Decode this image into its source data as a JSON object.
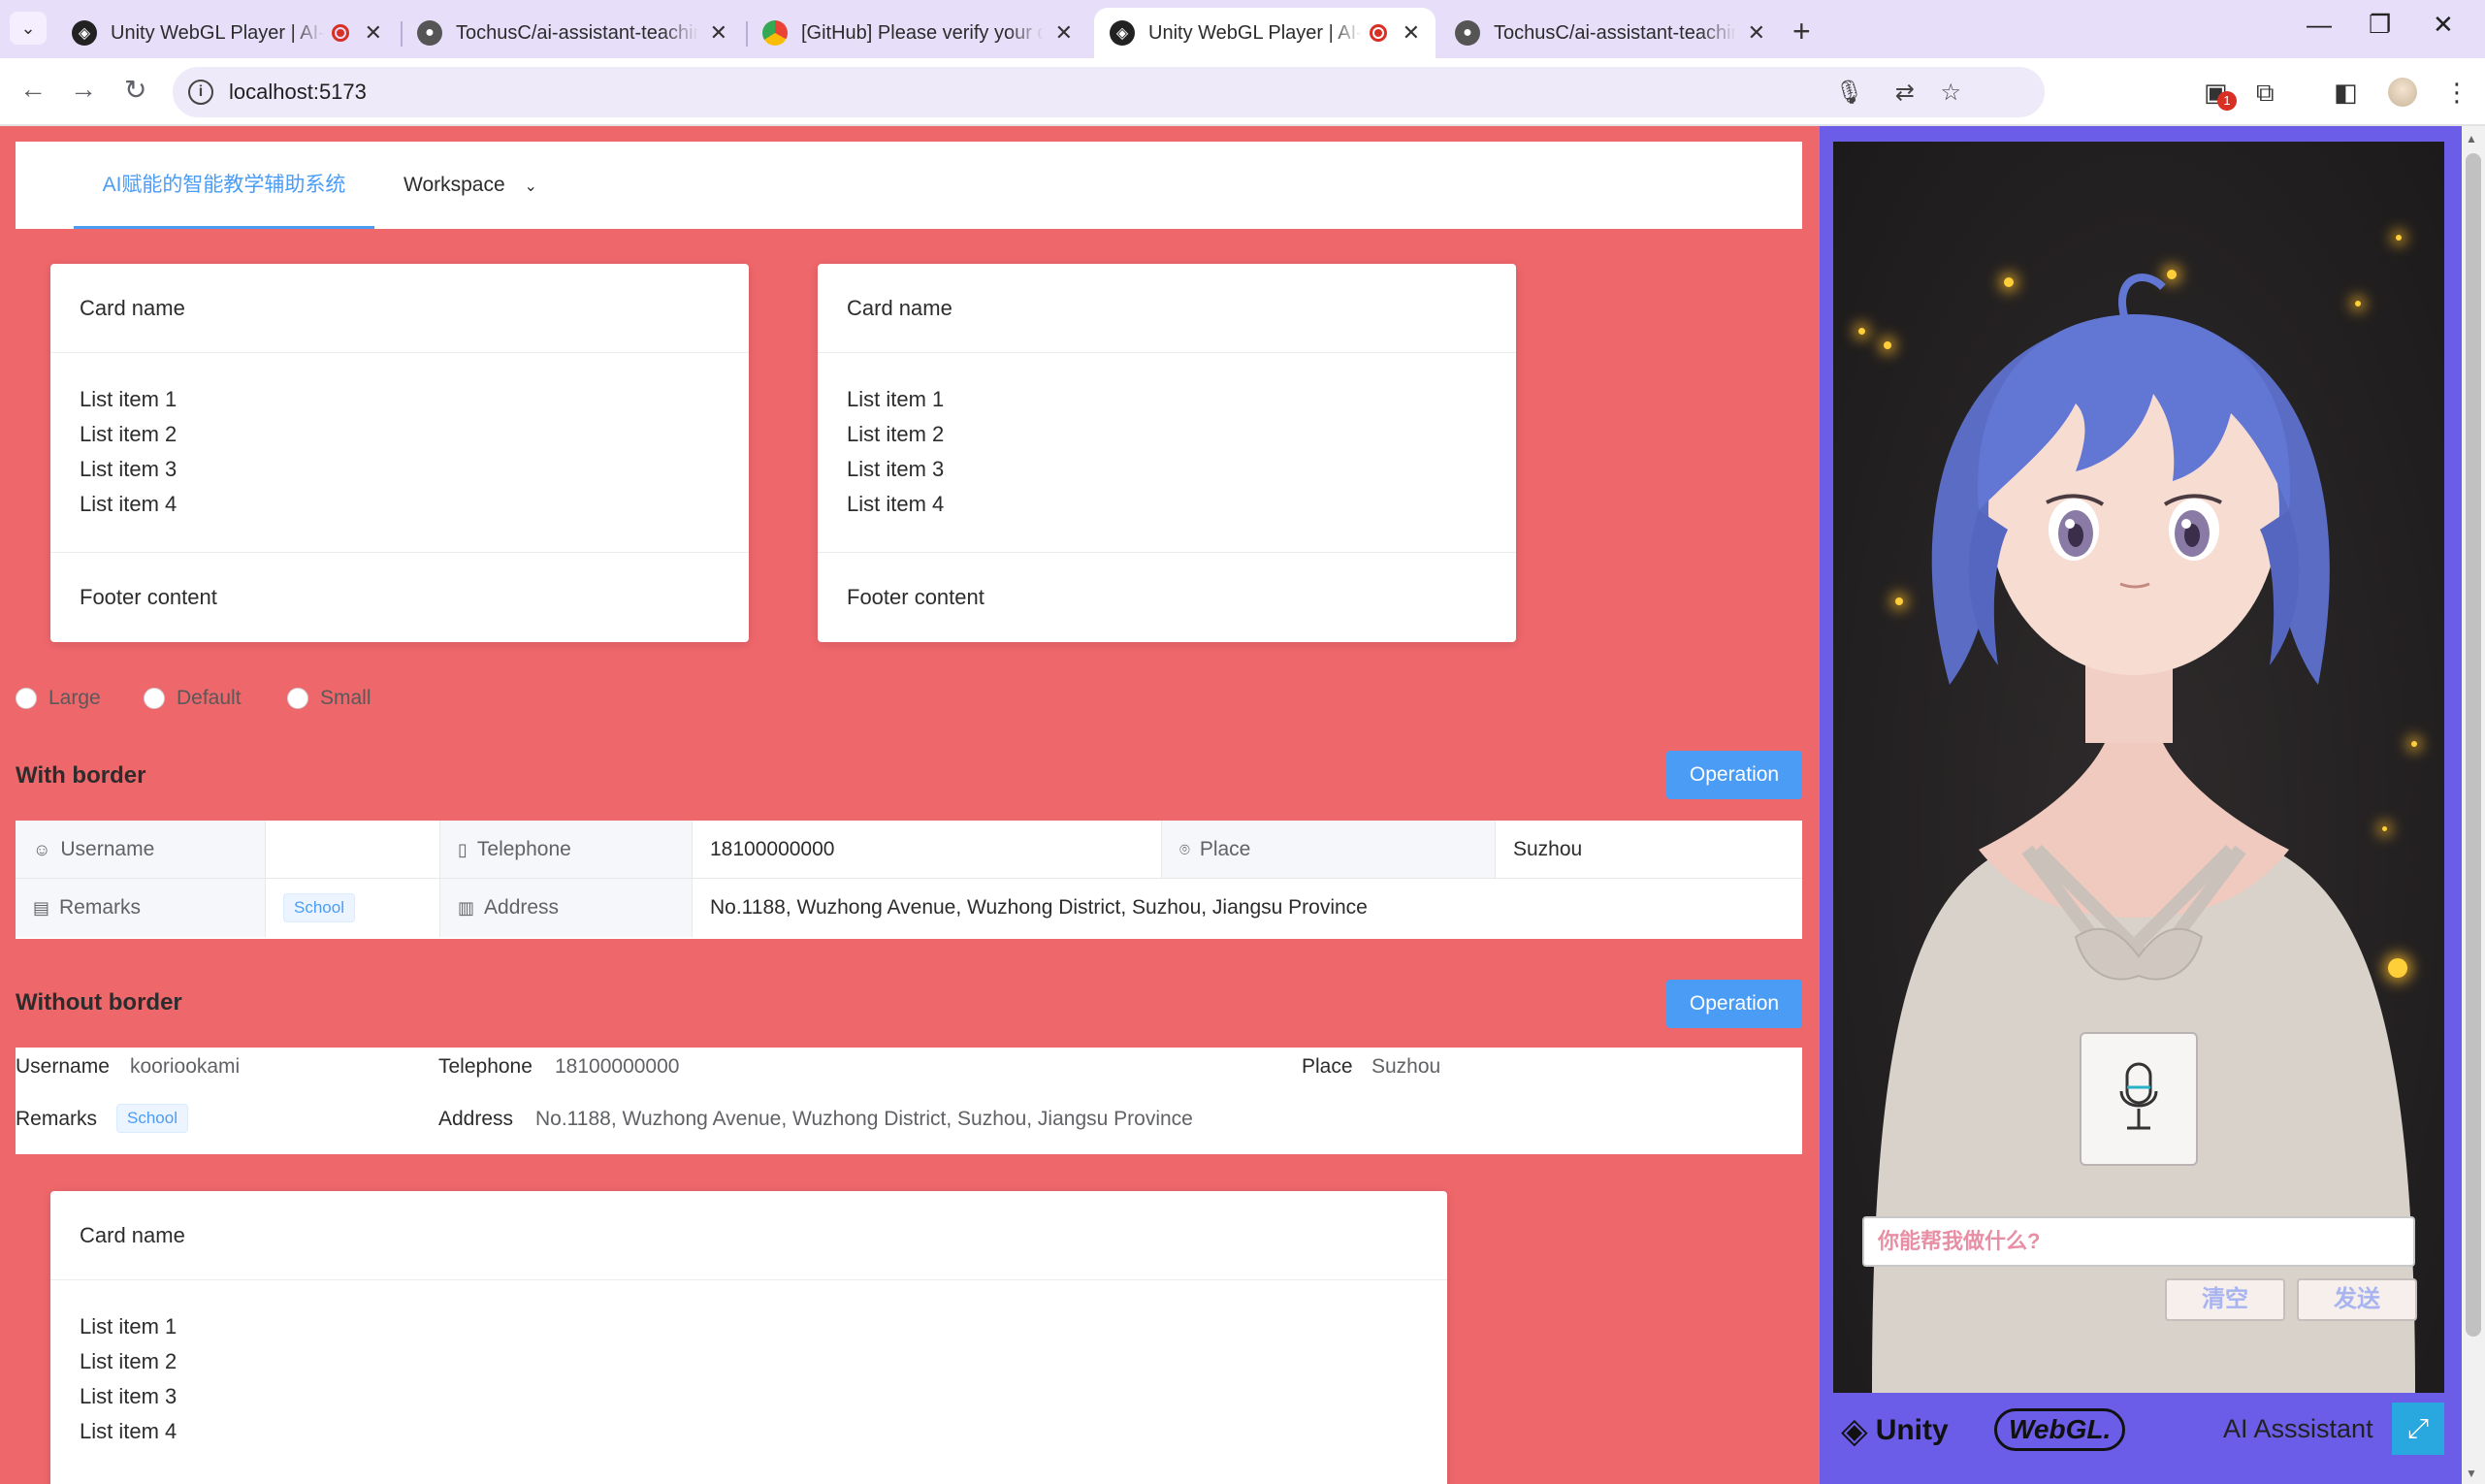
{
  "browser": {
    "tabs": [
      {
        "title": "Unity WebGL Player | AI-Assistant",
        "recording": true,
        "active": false,
        "favicon": "unity-icon"
      },
      {
        "title": "TochusC/ai-assistant-teaching",
        "recording": false,
        "active": false,
        "favicon": "github-icon"
      },
      {
        "title": "[GitHub] Please verify your device",
        "recording": false,
        "active": false,
        "favicon": "gmail-icon"
      },
      {
        "title": "Unity WebGL Player | AI-Assistant",
        "recording": true,
        "active": true,
        "favicon": "unity-icon"
      },
      {
        "title": "TochusC/ai-assistant-teaching",
        "recording": false,
        "active": false,
        "favicon": "github-icon"
      }
    ],
    "url": "localhost:5173",
    "extension_badge": "1"
  },
  "menu": {
    "items": [
      {
        "label": "AI赋能的智能教学辅助系统",
        "active": true
      },
      {
        "label": "Workspace",
        "active": false,
        "has_dropdown": true
      }
    ]
  },
  "cards": [
    {
      "header": "Card name",
      "items": [
        "List item 1",
        "List item 2",
        "List item 3",
        "List item 4"
      ],
      "footer": "Footer content"
    },
    {
      "header": "Card name",
      "items": [
        "List item 1",
        "List item 2",
        "List item 3",
        "List item 4"
      ],
      "footer": "Footer content"
    },
    {
      "header": "Card name",
      "items": [
        "List item 1",
        "List item 2",
        "List item 3",
        "List item 4"
      ],
      "footer": ""
    }
  ],
  "size_options": [
    "Large",
    "Default",
    "Small"
  ],
  "with_border": {
    "title": "With border",
    "operation": "Operation",
    "fields": {
      "username_label": "Username",
      "username_value": "",
      "telephone_label": "Telephone",
      "telephone_value": "18100000000",
      "place_label": "Place",
      "place_value": "Suzhou",
      "remarks_label": "Remarks",
      "remarks_tag": "School",
      "address_label": "Address",
      "address_value": "No.1188, Wuzhong Avenue, Wuzhong District, Suzhou, Jiangsu Province"
    }
  },
  "without_border": {
    "title": "Without border",
    "operation": "Operation",
    "fields": {
      "username_label": "Username",
      "username_value": "kooriookami",
      "telephone_label": "Telephone",
      "telephone_value": "18100000000",
      "place_label": "Place",
      "place_value": "Suzhou",
      "remarks_label": "Remarks",
      "remarks_tag": "School",
      "address_label": "Address",
      "address_value": "No.1188, Wuzhong Avenue, Wuzhong District, Suzhou, Jiangsu Province"
    }
  },
  "unity": {
    "input_placeholder": "你能帮我做什么?",
    "clear_button": "清空",
    "send_button": "发送",
    "logo_text": "Unity",
    "webgl_text": "WebGL.",
    "title": "AI Asssistant"
  },
  "colors": {
    "page_bg": "#ee676b",
    "accent": "#4b9cf5",
    "unity_frame": "#6c5de8"
  }
}
